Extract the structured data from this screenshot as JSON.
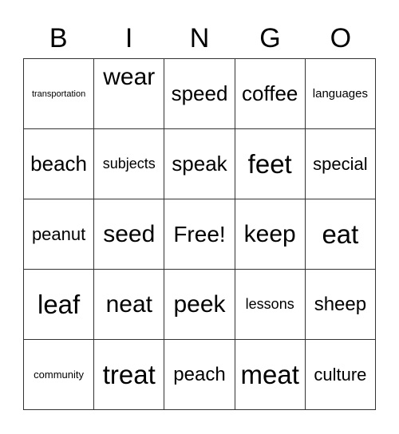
{
  "header": {
    "letters": [
      "B",
      "I",
      "N",
      "G",
      "O"
    ]
  },
  "card": {
    "rows": [
      [
        "transportation",
        "wear",
        "speed",
        "coffee",
        "languages"
      ],
      [
        "beach",
        "subjects",
        "speak",
        "feet",
        "special"
      ],
      [
        "peanut",
        "seed",
        "Free!",
        "keep",
        "eat"
      ],
      [
        "leaf",
        "neat",
        "peek",
        "lessons",
        "sheep"
      ],
      [
        "community",
        "treat",
        "peach",
        "meat",
        "culture"
      ]
    ]
  },
  "colors": {
    "text": "#000000",
    "grid_lines": "#333333",
    "background": "#ffffff"
  }
}
